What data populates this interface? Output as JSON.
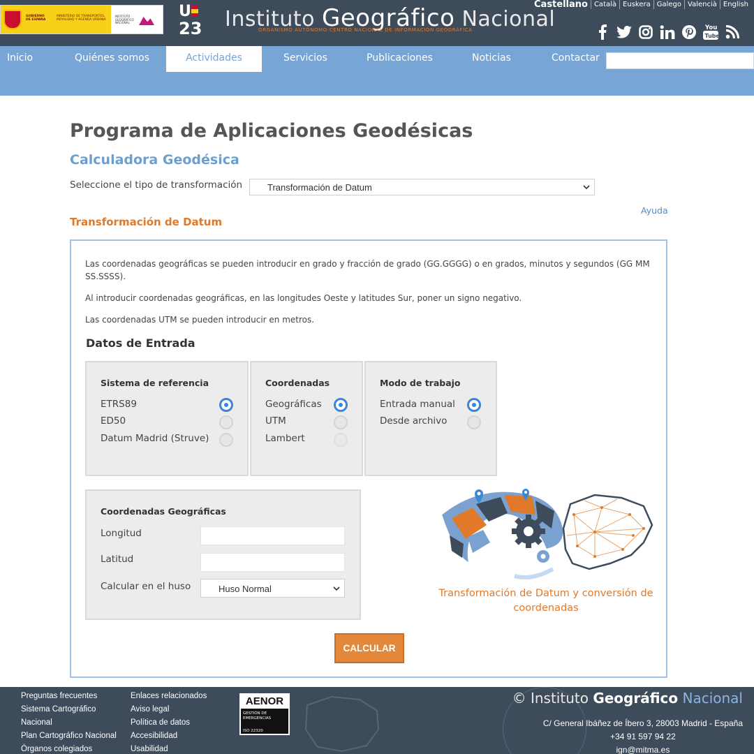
{
  "header": {
    "gov": {
      "gobierno": "GOBIERNO DE ESPAÑA",
      "ministerio": "MINISTERIO DE TRANSPORTES, MOVILIDAD Y AGENDA URBANA",
      "instituto": "INSTITUTO GEOGRÁFICO NACIONAL"
    },
    "u23": {
      "letter": "U",
      "number": "23"
    },
    "title_part1": "Instituto ",
    "title_part2": "Geográfico",
    "title_part3": " Nacional",
    "subtitle": "Organismo Autónomo    Centro Nacional de Información Geográfica",
    "languages": [
      "Castellano",
      "Català",
      "Euskera",
      "Galego",
      "Valencià",
      "English"
    ],
    "social": [
      {
        "name": "facebook-icon",
        "glyph": "f"
      },
      {
        "name": "twitter-icon",
        "glyph": "t"
      },
      {
        "name": "instagram-icon",
        "glyph": "◎"
      },
      {
        "name": "linkedin-icon",
        "glyph": "in"
      },
      {
        "name": "pinterest-icon",
        "glyph": "℗"
      },
      {
        "name": "youtube-icon",
        "glyph": "▶"
      },
      {
        "name": "rss-icon",
        "glyph": "))"
      }
    ]
  },
  "nav": {
    "items": [
      "Inicio",
      "Quiénes somos",
      "Actividades",
      "Servicios",
      "Publicaciones",
      "Noticias",
      "Contactar"
    ],
    "active_index": 2,
    "search_placeholder": ""
  },
  "main": {
    "page_title": "Programa de Aplicaciones Geodésicas",
    "calc_title": "Calculadora Geodésica",
    "transform_label": "Seleccione el tipo de transformación",
    "transform_value": "Transformación de Datum",
    "help_link": "Ayuda",
    "section_title": "Transformación de Datum",
    "info": [
      "Las coordenadas geográficas se pueden introducir en grado y fracción de grado (GG.GGGG) o en grados, minutos y segundos (GG MM SS.SSSS).",
      "Al introducir coordenadas geográficas, en las longitudes Oeste y latitudes Sur, poner un signo negativo.",
      "Las coordenadas UTM se pueden introducir en metros."
    ],
    "datos_title": "Datos de Entrada",
    "ref_system": {
      "title": "Sistema de referencia",
      "options": [
        "ETRS89",
        "ED50",
        "Datum Madrid (Struve)"
      ],
      "selected": "ETRS89"
    },
    "coordinates": {
      "title": "Coordenadas",
      "options": [
        "Geográficas",
        "UTM",
        "Lambert"
      ],
      "selected": "Geográficas"
    },
    "work_mode": {
      "title": "Modo de trabajo",
      "options": [
        "Entrada manual",
        "Desde archivo"
      ],
      "selected": "Entrada manual"
    },
    "geo_coords": {
      "title": "Coordenadas Geográficas",
      "longitud_label": "Longitud",
      "longitud_value": "",
      "latitud_label": "Latitud",
      "latitud_value": "",
      "huso_label": "Calcular en el huso",
      "huso_value": "Huso Normal"
    },
    "illustration_caption": "Transformación de Datum y conversión de coordenadas",
    "calc_button": "CALCULAR"
  },
  "footer": {
    "col1": [
      "Preguntas frecuentes",
      "Sistema Cartográfico",
      "Nacional",
      "Plan Cartográfico Nacional",
      "Órganos colegiados"
    ],
    "col2": [
      "Enlaces relacionados",
      "Aviso legal",
      "Política de datos",
      "Accesibilidad",
      "Usabilidad"
    ],
    "aenor_title": "AENOR",
    "aenor_sub": "GESTIÓN DE EMERGENCIAS",
    "aenor_code": "ISO 22320",
    "copyright_prefix": "© Instituto ",
    "copyright_bold": "Geográfico",
    "copyright_suffix": " Nacional",
    "address": "C/ General Ibáñez de Íbero 3, 28003 Madrid - España",
    "phone": "+34 91 597 94 22",
    "email": "ign@mitma.es"
  },
  "colors": {
    "header_bg": "#3e4b5b",
    "nav_bg": "#76a5d6",
    "accent_orange": "#e0792a",
    "accent_blue": "#6c9fd0",
    "radio_blue": "#3b86d6"
  }
}
